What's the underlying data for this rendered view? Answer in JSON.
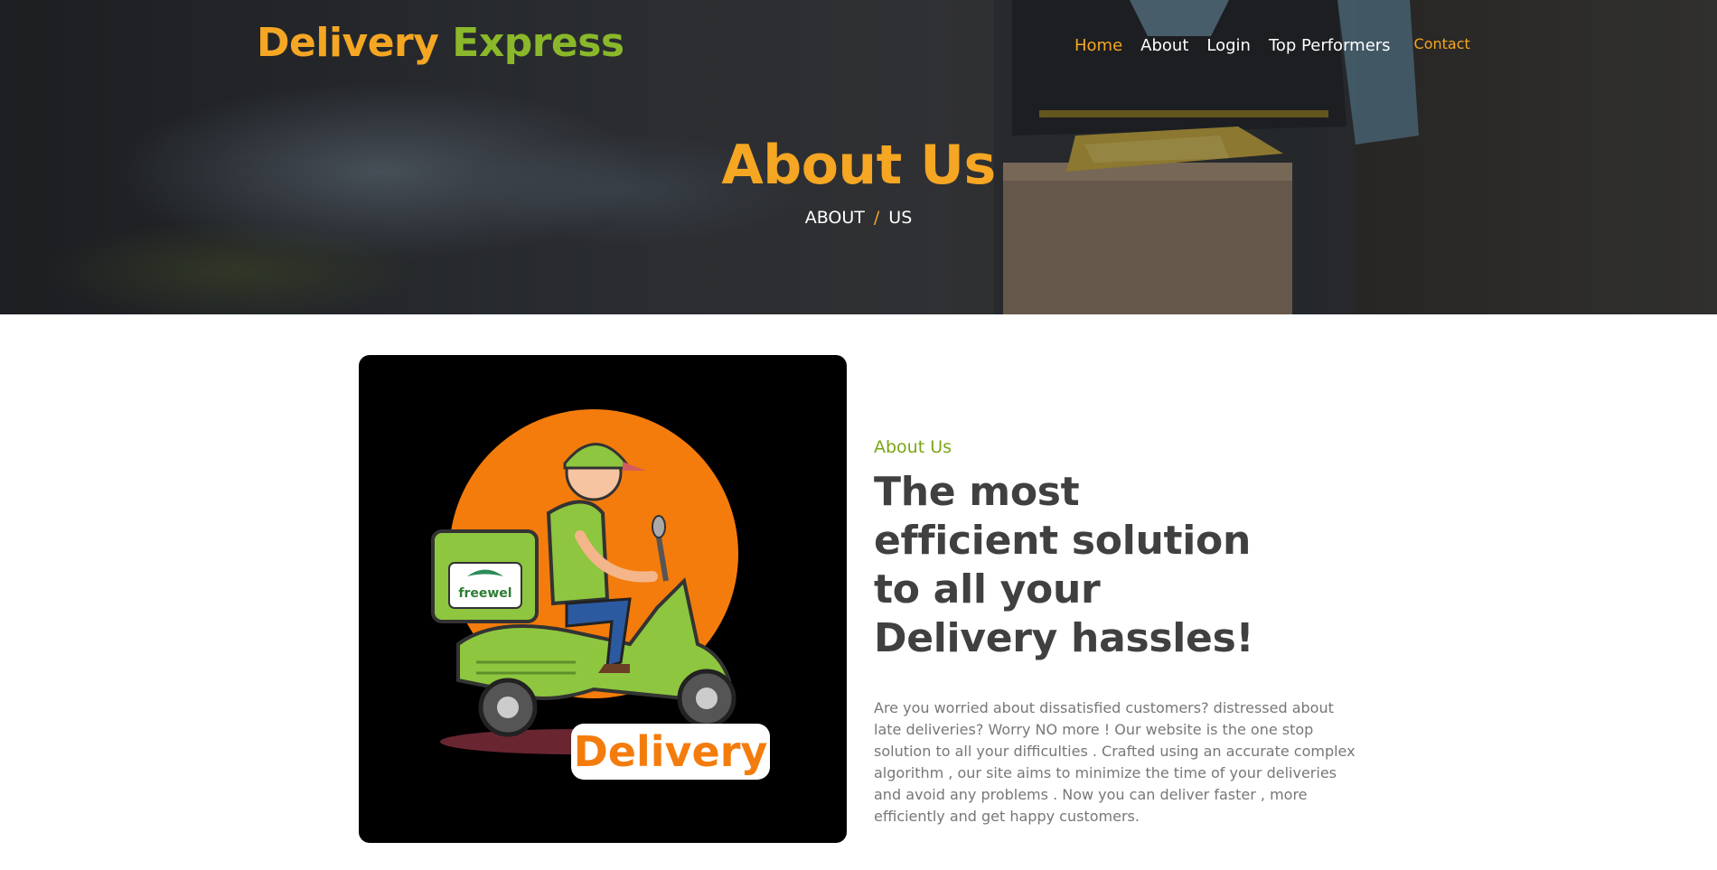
{
  "navbar": {
    "brand_part1": "Delivery",
    "brand_part2": "Express",
    "links": [
      {
        "label": "Home",
        "active": true
      },
      {
        "label": "About"
      },
      {
        "label": "Login"
      },
      {
        "label": "Top Performers"
      },
      {
        "label": "Contact"
      }
    ]
  },
  "hero": {
    "title": "About Us",
    "breadcrumb": {
      "part1": "ABOUT",
      "separator": "/",
      "part2": "US"
    }
  },
  "about": {
    "image": {
      "badge_text": "Delivery",
      "box_logo_text": "freewel"
    },
    "subtitle": "About Us",
    "headline": "The most efficient solution to all your Delivery hassles!",
    "description": "Are you worried about dissatisfied customers? distressed about late deliveries? Worry NO more ! Our website is the one stop solution to all your difficulties . Crafted using an accurate complex algorithm , our site aims to minimize the time of your deliveries and avoid any problems . Now you can deliver faster , more efficiently and get happy customers."
  },
  "colors": {
    "accent_orange": "#f5a623",
    "accent_green": "#8ab82a",
    "headline": "#404040",
    "body_text": "#777777"
  }
}
